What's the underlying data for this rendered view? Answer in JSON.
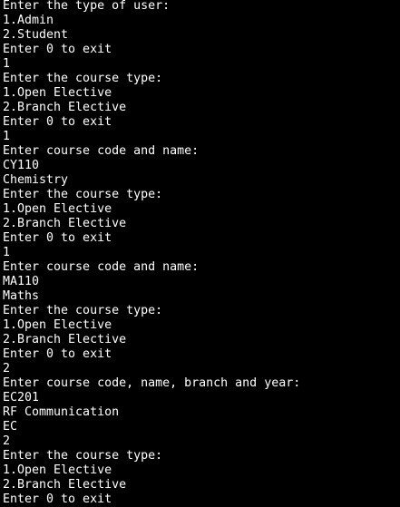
{
  "terminal": {
    "lines": [
      "Enter the type of user:",
      "1.Admin",
      "2.Student",
      "Enter 0 to exit",
      "1",
      "Enter the course type:",
      "1.Open Elective",
      "2.Branch Elective",
      "Enter 0 to exit",
      "1",
      "Enter course code and name:",
      "CY110",
      "Chemistry",
      "Enter the course type:",
      "1.Open Elective",
      "2.Branch Elective",
      "Enter 0 to exit",
      "1",
      "Enter course code and name:",
      "MA110",
      "Maths",
      "Enter the course type:",
      "1.Open Elective",
      "2.Branch Elective",
      "Enter 0 to exit",
      "2",
      "Enter course code, name, branch and year:",
      "EC201",
      "RF Communication",
      "EC",
      "2",
      "Enter the course type:",
      "1.Open Elective",
      "2.Branch Elective",
      "Enter 0 to exit"
    ]
  },
  "colors": {
    "background": "#000000",
    "foreground": "#ffffff"
  }
}
